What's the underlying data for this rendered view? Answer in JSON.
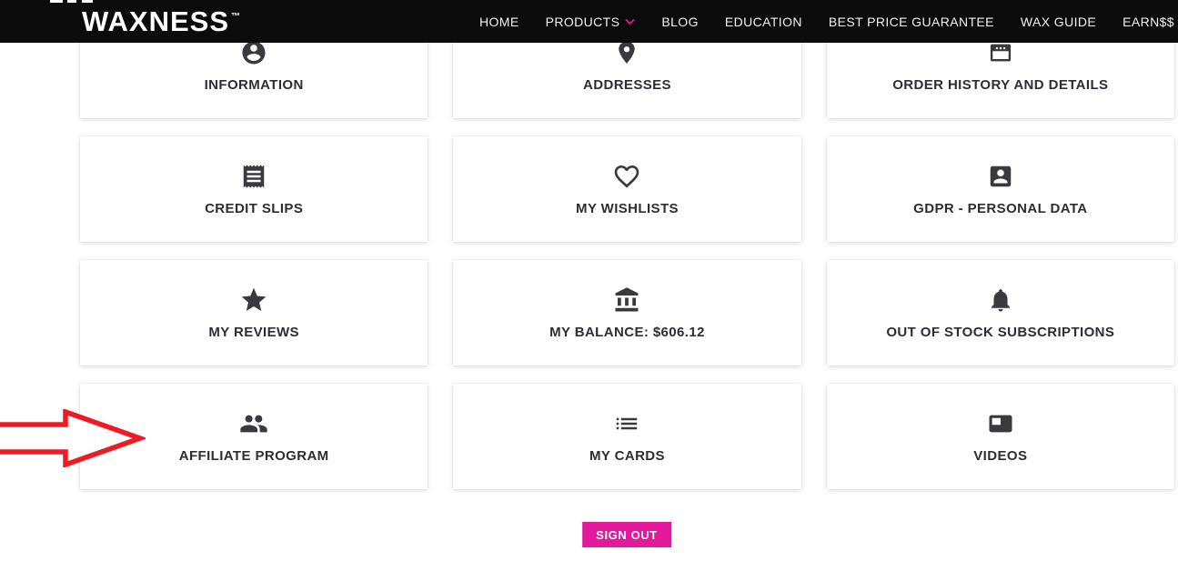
{
  "brand": {
    "logo": "WAXNESS",
    "tm": "™"
  },
  "nav": {
    "items": [
      {
        "label": "HOME"
      },
      {
        "label": "PRODUCTS",
        "has_dropdown": true
      },
      {
        "label": "BLOG"
      },
      {
        "label": "EDUCATION"
      },
      {
        "label": "BEST PRICE GUARANTEE"
      },
      {
        "label": "WAX GUIDE"
      },
      {
        "label": "EARN$$"
      }
    ]
  },
  "account_tiles": [
    {
      "label": "INFORMATION",
      "icon": "account-circle-icon"
    },
    {
      "label": "ADDRESSES",
      "icon": "map-pin-icon"
    },
    {
      "label": "ORDER HISTORY AND DETAILS",
      "icon": "order-window-icon"
    },
    {
      "label": "CREDIT SLIPS",
      "icon": "receipt-icon"
    },
    {
      "label": "MY WISHLISTS",
      "icon": "heart-outline-icon"
    },
    {
      "label": "GDPR - PERSONAL DATA",
      "icon": "id-card-icon"
    },
    {
      "label": "MY REVIEWS",
      "icon": "star-icon"
    },
    {
      "label": "MY BALANCE: $606.12",
      "icon": "bank-icon"
    },
    {
      "label": "OUT OF STOCK SUBSCRIPTIONS",
      "icon": "bell-icon"
    },
    {
      "label": "AFFILIATE PROGRAM",
      "icon": "people-icon"
    },
    {
      "label": "MY CARDS",
      "icon": "list-icon"
    },
    {
      "label": "VIDEOS",
      "icon": "featured-video-icon"
    }
  ],
  "sign_out": {
    "label": "SIGN OUT"
  },
  "annotation": {
    "type": "red-arrow",
    "points_to": "AFFILIATE PROGRAM"
  },
  "colors": {
    "accent_pink": "#e2199b",
    "arrow_red": "#ed1c24",
    "nav_bg": "#0b0b0b",
    "icon_color": "#3a3a3e",
    "label_color": "#2d2d35"
  }
}
